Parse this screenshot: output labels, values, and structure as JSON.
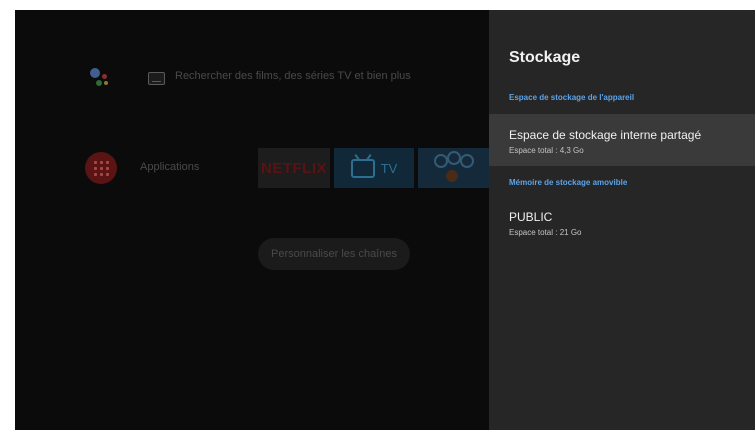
{
  "home": {
    "search_placeholder": "Rechercher des films, des séries TV et bien plus",
    "apps_label": "Applications",
    "netflix_label": "NETFLIX",
    "tv_label": "TV",
    "customize_channels_label": "Personnaliser les chaînes"
  },
  "panel": {
    "title": "Stockage",
    "device_section_header": "Espace de stockage de l'appareil",
    "internal": {
      "title": "Espace de stockage interne partagé",
      "subtitle": "Espace total : 4,3 Go"
    },
    "removable_section_header": "Mémoire de stockage amovible",
    "public": {
      "title": "PUBLIC",
      "subtitle": "Espace total : 21 Go"
    }
  },
  "colors": {
    "panel_bg": "#262626",
    "selected_row_bg": "#3a3a3a",
    "section_header": "#5da3e8",
    "home_bg": "#0b0b0b"
  }
}
